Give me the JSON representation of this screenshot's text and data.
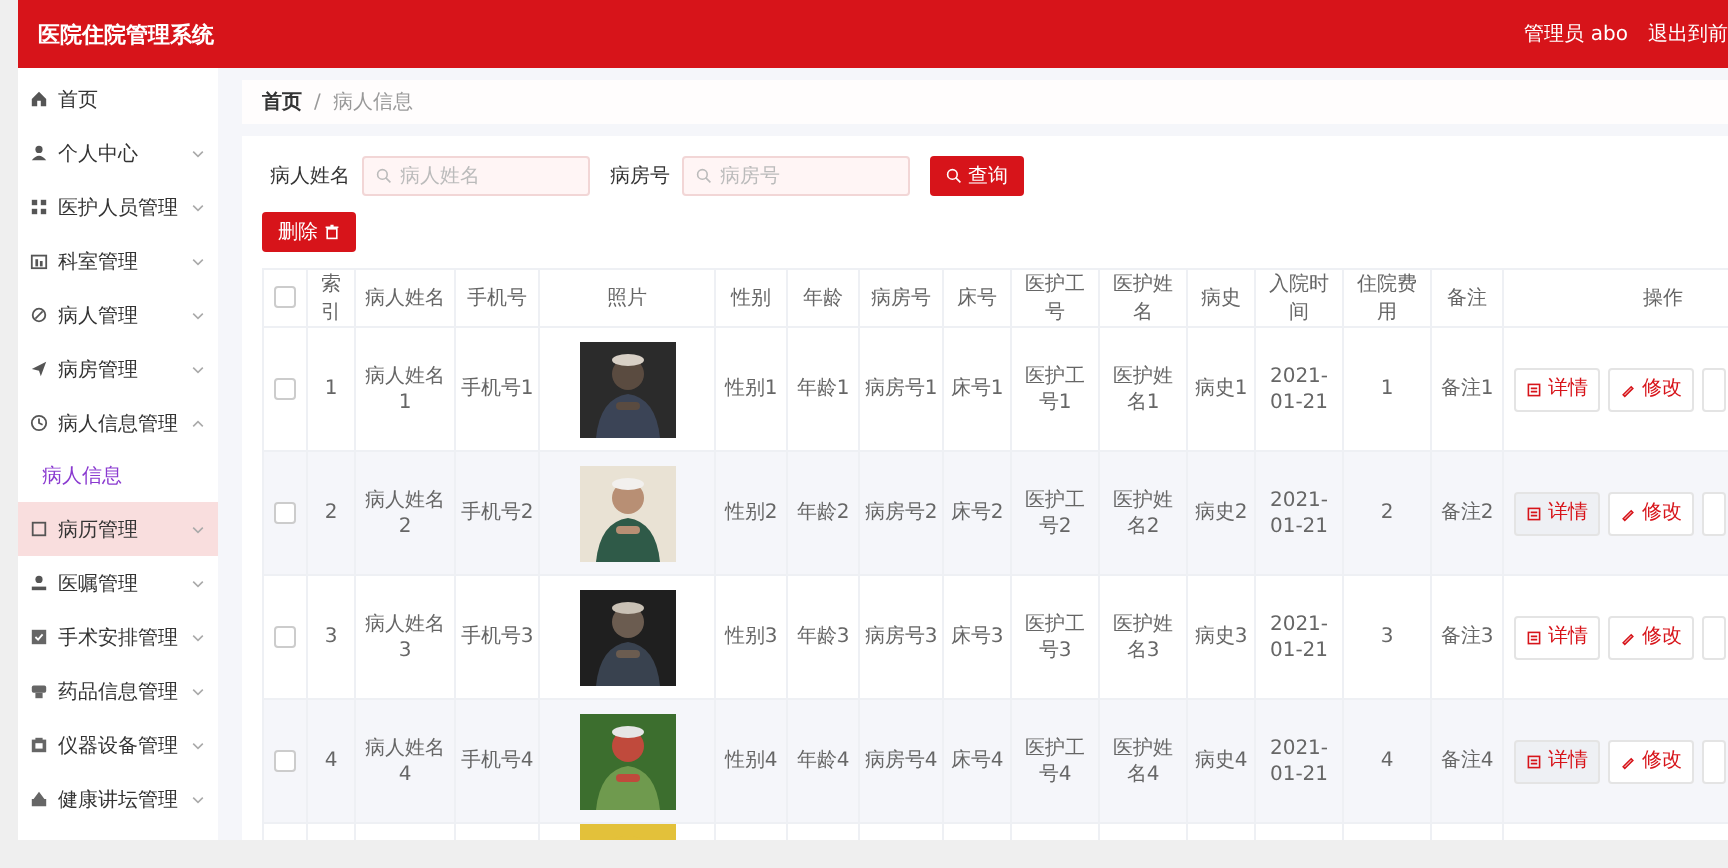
{
  "header": {
    "title": "医院住院管理系统",
    "user": "管理员 abo",
    "logout": "退出到前"
  },
  "sidebar": {
    "items": [
      {
        "label": "首页",
        "kind": "link",
        "selected": false
      },
      {
        "label": "个人中心",
        "kind": "menu",
        "expanded": false,
        "selected": false
      },
      {
        "label": "医护人员管理",
        "kind": "menu",
        "expanded": false,
        "selected": false
      },
      {
        "label": "科室管理",
        "kind": "menu",
        "expanded": false,
        "selected": false
      },
      {
        "label": "病人管理",
        "kind": "menu",
        "expanded": false,
        "selected": false
      },
      {
        "label": "病房管理",
        "kind": "menu",
        "expanded": false,
        "selected": false
      },
      {
        "label": "病人信息管理",
        "kind": "menu",
        "expanded": true,
        "selected": false,
        "children": [
          {
            "label": "病人信息",
            "selected": true
          }
        ]
      },
      {
        "label": "病历管理",
        "kind": "menu",
        "expanded": false,
        "selected": true
      },
      {
        "label": "医嘱管理",
        "kind": "menu",
        "expanded": false,
        "selected": false
      },
      {
        "label": "手术安排管理",
        "kind": "menu",
        "expanded": false,
        "selected": false
      },
      {
        "label": "药品信息管理",
        "kind": "menu",
        "expanded": false,
        "selected": false
      },
      {
        "label": "仪器设备管理",
        "kind": "menu",
        "expanded": false,
        "selected": false
      },
      {
        "label": "健康讲坛管理",
        "kind": "menu",
        "expanded": false,
        "selected": false
      }
    ]
  },
  "breadcrumb": {
    "items": [
      "首页",
      "病人信息"
    ],
    "separator": "/"
  },
  "search": {
    "fields": [
      {
        "label": "病人姓名",
        "placeholder": "病人姓名"
      },
      {
        "label": "病房号",
        "placeholder": "病房号"
      }
    ],
    "button": "查询"
  },
  "delete_button": "删除",
  "table": {
    "select_all_checked": false,
    "columns": [
      "索引",
      "病人姓名",
      "手机号",
      "照片",
      "性别",
      "年龄",
      "病房号",
      "床号",
      "医护工号",
      "医护姓名",
      "病史",
      "入院时间",
      "住院费用",
      "备注",
      "操作"
    ],
    "rows": [
      {
        "checked": false,
        "shaded": false,
        "cells": [
          "1",
          "病人姓名1",
          "手机号1",
          {
            "kind": "picture"
          },
          "性别1",
          "年龄1",
          "病房号1",
          "床号1",
          "医护工号1",
          "医护姓名1",
          "病史1",
          "2021-01-21",
          "1",
          "备注1"
        ],
        "actions": [
          "详情",
          "修改"
        ]
      },
      {
        "checked": false,
        "shaded": true,
        "cells": [
          "2",
          "病人姓名2",
          "手机号2",
          {
            "kind": "picture"
          },
          "性别2",
          "年龄2",
          "病房号2",
          "床号2",
          "医护工号2",
          "医护姓名2",
          "病史2",
          "2021-01-21",
          "2",
          "备注2"
        ],
        "actions": [
          "详情",
          "修改"
        ]
      },
      {
        "checked": false,
        "shaded": false,
        "cells": [
          "3",
          "病人姓名3",
          "手机号3",
          {
            "kind": "picture"
          },
          "性别3",
          "年龄3",
          "病房号3",
          "床号3",
          "医护工号3",
          "医护姓名3",
          "病史3",
          "2021-01-21",
          "3",
          "备注3"
        ],
        "actions": [
          "详情",
          "修改"
        ]
      },
      {
        "checked": false,
        "shaded": true,
        "cells": [
          "4",
          "病人姓名4",
          "手机号4",
          {
            "kind": "picture"
          },
          "性别4",
          "年龄4",
          "病房号4",
          "床号4",
          "医护工号4",
          "医护姓名4",
          "病史4",
          "2021-01-21",
          "4",
          "备注4"
        ],
        "actions": [
          "详情",
          "修改"
        ]
      }
    ],
    "partial_row": {
      "photo": {
        "kind": "picture"
      }
    }
  }
}
